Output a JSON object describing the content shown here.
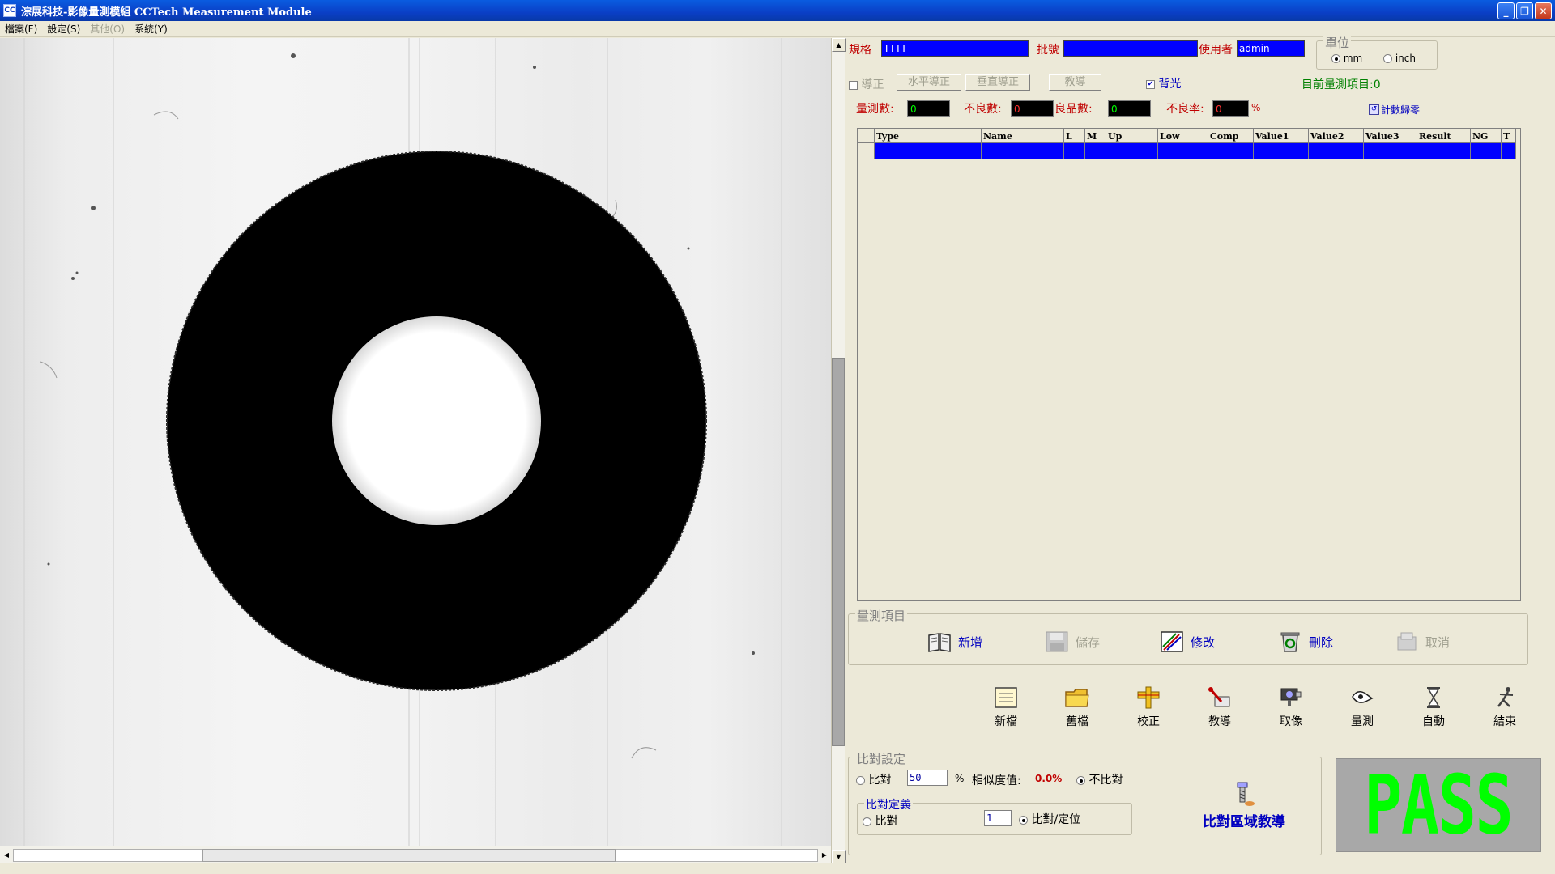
{
  "window": {
    "title": "淙展科技-影像量測模組 CCTech Measurement Module",
    "icon_text": "CC",
    "minimize_glyph": "_",
    "maximize_glyph": "❐",
    "close_glyph": "✕"
  },
  "menu": {
    "items": [
      {
        "label": "檔案(F)",
        "enabled": true
      },
      {
        "label": "設定(S)",
        "enabled": true
      },
      {
        "label": "其他(O)",
        "enabled": false
      },
      {
        "label": "系統(Y)",
        "enabled": true
      }
    ]
  },
  "header": {
    "spec_label": "規格",
    "spec_value": "TTTT",
    "lot_label": "批號",
    "lot_value": "",
    "user_label": "使用者",
    "user_value": "admin",
    "unit_group_title": "單位",
    "unit_options": [
      "mm",
      "inch"
    ],
    "unit_selected": "mm"
  },
  "correction": {
    "checkbox_label": "導正",
    "horizontal_button": "水平導正",
    "vertical_button": "垂直導正",
    "teach_button": "教導",
    "backlight_label": "背光",
    "backlight_checked": true,
    "current_items_text": "目前量測項目:0"
  },
  "counters": {
    "measure_count_label": "量測數:",
    "measure_count": "0",
    "ng_count_label": "不良數:",
    "ng_count": "0",
    "good_count_label": "良品數:",
    "good_count": "0",
    "ng_rate_label": "不良率:",
    "ng_rate": "0",
    "ng_rate_unit": "%",
    "reset_label": "計數歸零"
  },
  "table": {
    "columns": [
      "Type",
      "Name",
      "L",
      "M",
      "Up",
      "Low",
      "Comp",
      "Value1",
      "Value2",
      "Value3",
      "Result",
      "NG",
      "T"
    ]
  },
  "measure_items": {
    "group_title": "量測項目",
    "buttons": [
      {
        "label": "新增",
        "icon": "book-icon",
        "enabled": true
      },
      {
        "label": "儲存",
        "icon": "floppy-icon",
        "enabled": false
      },
      {
        "label": "修改",
        "icon": "edit-icon",
        "enabled": true
      },
      {
        "label": "刪除",
        "icon": "recycle-icon",
        "enabled": true
      },
      {
        "label": "取消",
        "icon": "cancel-icon",
        "enabled": false
      }
    ]
  },
  "toolbar": {
    "tools": [
      {
        "label": "新檔",
        "icon": "new-file-icon"
      },
      {
        "label": "舊檔",
        "icon": "folder-icon"
      },
      {
        "label": "校正",
        "icon": "calibrate-icon"
      },
      {
        "label": "教導",
        "icon": "teach-icon"
      },
      {
        "label": "取像",
        "icon": "camera-icon"
      },
      {
        "label": "量測",
        "icon": "measure-icon"
      },
      {
        "label": "自動",
        "icon": "hourglass-icon"
      },
      {
        "label": "結束",
        "icon": "exit-icon"
      }
    ]
  },
  "compare": {
    "group_title": "比對設定",
    "compare_label": "比對",
    "compare_value": "50",
    "percent_sign": "%",
    "similarity_label": "相似度值:",
    "similarity_value": "0.0%",
    "no_compare_label": "不比對",
    "no_compare_selected": true,
    "define_group_title": "比對定義",
    "define_compare_label": "比對",
    "define_value": "1",
    "define_locate_label": "比對/定位",
    "define_locate_selected": true,
    "region_teach_label": "比對區域教導"
  },
  "result": {
    "text": "PASS",
    "color": "#00ff00"
  },
  "scroll": {
    "up_glyph": "▲",
    "down_glyph": "▼",
    "left_glyph": "◀",
    "right_glyph": "▶"
  }
}
